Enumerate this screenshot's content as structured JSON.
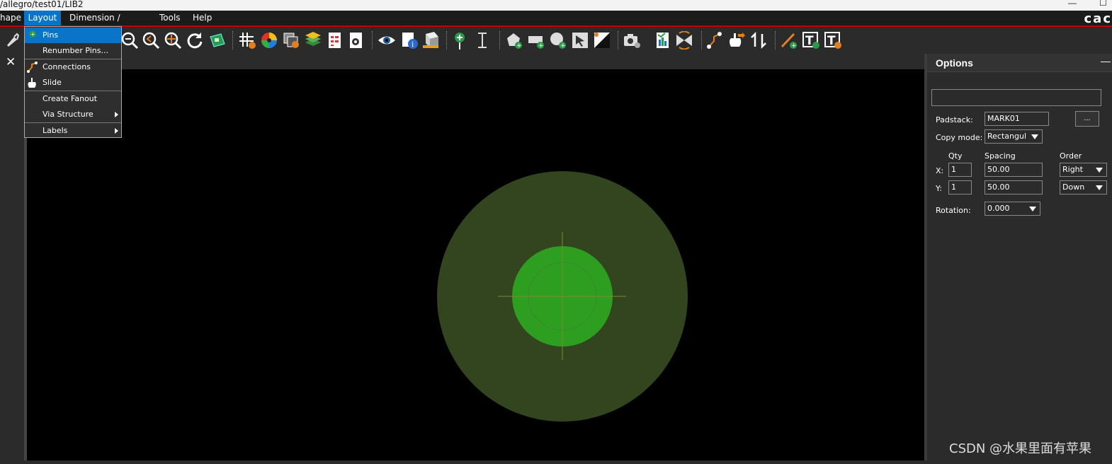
{
  "window": {
    "path": "/allegro/test01/LIB2",
    "minimize": "—",
    "maximize": "☐"
  },
  "menubar": {
    "items": [
      "hape",
      "Layout",
      "Dimension / Drafting",
      "Tools",
      "Help"
    ],
    "active": "Layout",
    "brand": "cac"
  },
  "layout_menu": {
    "items": [
      {
        "label": "Pins",
        "selected": true
      },
      {
        "label": "Renumber Pins..."
      },
      {
        "label": "Connections"
      },
      {
        "label": "Slide"
      },
      {
        "label": "Create Fanout"
      },
      {
        "label": "Via Structure",
        "submenu": true
      },
      {
        "label": "Labels",
        "submenu": true
      }
    ]
  },
  "left_panel": {
    "close": "✕"
  },
  "toolbar": {
    "icons": [
      "pin-tool-icon",
      "zoom-out-icon",
      "zoom-previous-icon",
      "zoom-fit-icon",
      "redraw-icon",
      "3d-view-icon",
      "grid-icon",
      "color-icon",
      "shadow-icon",
      "layers-icon",
      "report-icon",
      "settings-icon",
      "visibility-icon",
      "info-icon",
      "measure-icon",
      "add-pin-icon",
      "dimension-icon",
      "add-shape-icon",
      "add-rect-icon",
      "add-circle-icon",
      "select-shape-icon",
      "void-icon",
      "snapshot-icon",
      "status-icon",
      "swap-icon",
      "connect-icon",
      "slide-icon",
      "swap-pins-icon",
      "add-line-icon",
      "add-text-icon",
      "edit-text-icon"
    ]
  },
  "options": {
    "title": "Options",
    "padstack_label": "Padstack:",
    "padstack_value": "MARK01",
    "browse_label": "...",
    "copy_mode_label": "Copy mode:",
    "copy_mode_value": "Rectangul",
    "qty_header": "Qty",
    "spacing_header": "Spacing",
    "order_header": "Order",
    "x_label": "X:",
    "x_qty": "1",
    "x_spacing": "50.00",
    "x_order": "Right",
    "y_label": "Y:",
    "y_qty": "1",
    "y_spacing": "50.00",
    "y_order": "Down",
    "rotation_label": "Rotation:",
    "rotation_value": "0.000"
  },
  "colors": {
    "menu_active": "#0a74c9",
    "accent_red": "#c00000",
    "pad_outer": "#32451f",
    "pad_inner": "#2d9e1f"
  },
  "watermark": "CSDN @水果里面有苹果"
}
